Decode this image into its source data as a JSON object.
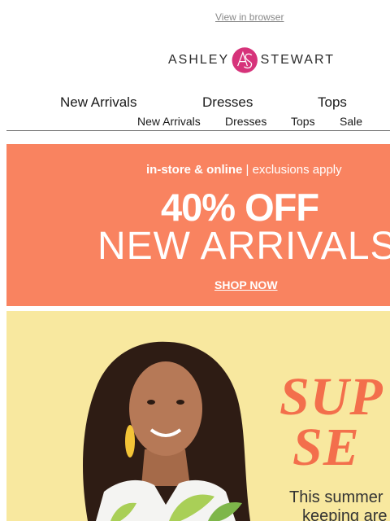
{
  "header": {
    "view_in_browser": "View in browser",
    "logo_left": "ASHLEY",
    "logo_right": "STEWART",
    "logo_color": "#d6337a"
  },
  "nav": {
    "primary": [
      "New Arrivals",
      "Dresses",
      "Tops"
    ],
    "secondary": [
      "New Arrivals",
      "Dresses",
      "Tops",
      "Sale"
    ]
  },
  "promo": {
    "tagline_bold": "in-store & online",
    "tagline_sep": " | ",
    "tagline_rest": "exclusions apply",
    "headline": "40% OFF",
    "subheadline": "NEW ARRIVALS",
    "cta": "SHOP NOW",
    "background": "#f98360"
  },
  "hero": {
    "title_line1": "SUP",
    "title_line2": "SE",
    "copy_line1": "This summer",
    "copy_line2": "keeping are",
    "background": "#f8e89f",
    "title_color": "#f36f4c"
  }
}
